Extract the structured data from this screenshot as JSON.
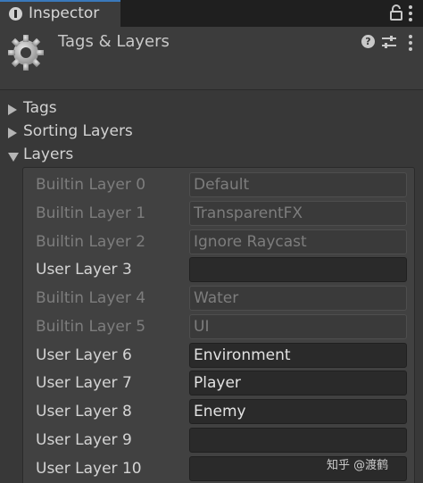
{
  "tab": {
    "label": "Inspector"
  },
  "header": {
    "title": "Tags & Layers"
  },
  "foldouts": [
    {
      "label": "Tags",
      "expanded": false
    },
    {
      "label": "Sorting Layers",
      "expanded": false
    },
    {
      "label": "Layers",
      "expanded": true
    }
  ],
  "layers": [
    {
      "label": "Builtin Layer 0",
      "value": "Default",
      "builtin": true
    },
    {
      "label": "Builtin Layer 1",
      "value": "TransparentFX",
      "builtin": true
    },
    {
      "label": "Builtin Layer 2",
      "value": "Ignore Raycast",
      "builtin": true
    },
    {
      "label": "User Layer 3",
      "value": "",
      "builtin": false
    },
    {
      "label": "Builtin Layer 4",
      "value": "Water",
      "builtin": true
    },
    {
      "label": "Builtin Layer 5",
      "value": "UI",
      "builtin": true
    },
    {
      "label": "User Layer 6",
      "value": "Environment",
      "builtin": false
    },
    {
      "label": "User Layer 7",
      "value": "Player",
      "builtin": false
    },
    {
      "label": "User Layer 8",
      "value": "Enemy",
      "builtin": false
    },
    {
      "label": "User Layer 9",
      "value": "",
      "builtin": false
    },
    {
      "label": "User Layer 10",
      "value": "",
      "builtin": false
    }
  ],
  "watermark": "知乎 @渡鹤"
}
